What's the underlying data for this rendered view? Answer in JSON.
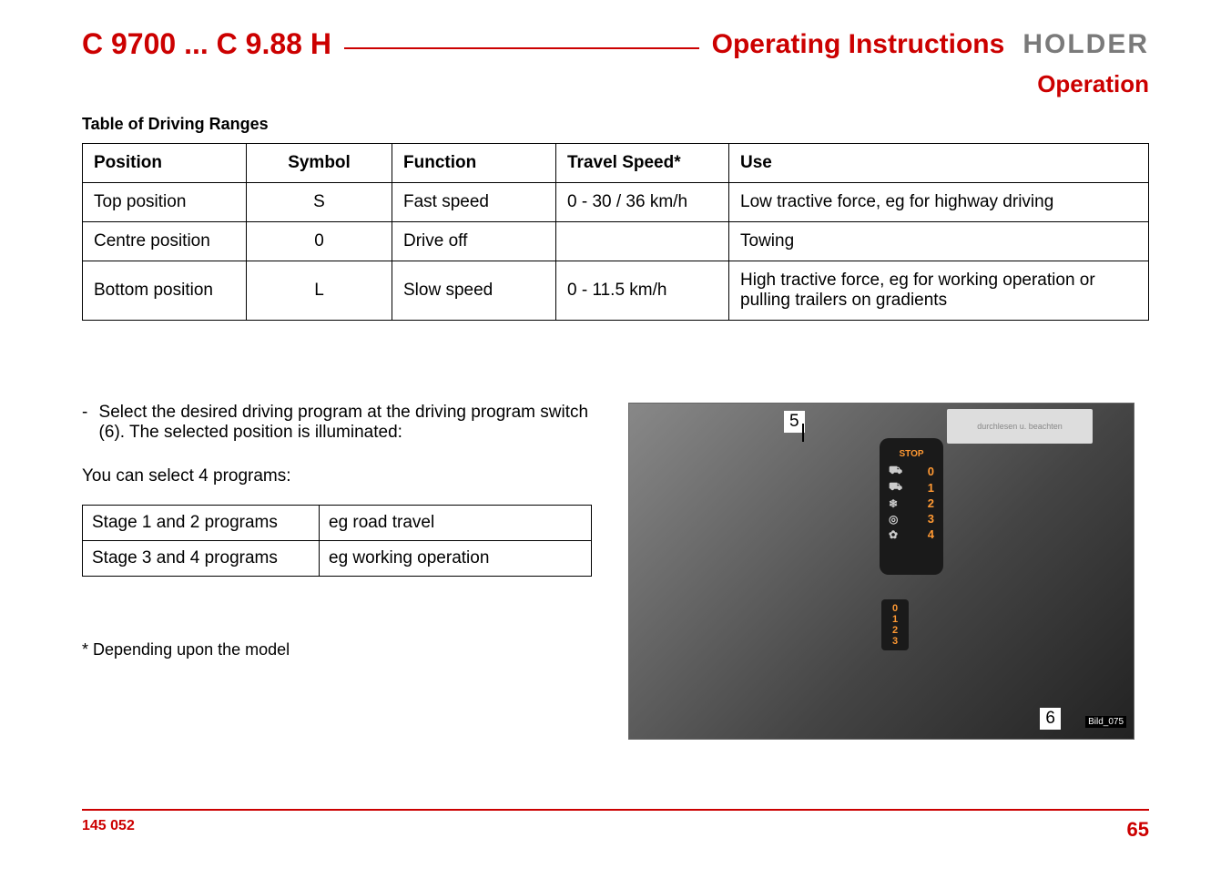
{
  "header": {
    "model": "C 9700 ... C 9.88 H",
    "doc_title": "Operating Instructions",
    "logo": "HOLDER"
  },
  "section_title": "Operation",
  "table": {
    "caption": "Table of Driving Ranges",
    "headers": [
      "Position",
      "Symbol",
      "Function",
      "Travel Speed*",
      "Use"
    ],
    "rows": [
      {
        "position": "Top position",
        "symbol": "S",
        "function": "Fast speed",
        "speed": "0 - 30 / 36 km/h",
        "use": "Low tractive force, eg for highway driving"
      },
      {
        "position": "Centre position",
        "symbol": "0",
        "function": "Drive off",
        "speed": "",
        "use": "Towing"
      },
      {
        "position": "Bottom position",
        "symbol": "L",
        "function": "Slow speed",
        "speed": "0 - 11.5 km/h",
        "use": "High tractive force, eg for working operation or pulling trailers on gradients"
      }
    ]
  },
  "instruction_text": "Select the desired driving program at the driving program switch (6). The selected position is illuminated:",
  "programs_intro": "You can select 4 programs:",
  "programs": [
    {
      "stage": "Stage 1 and 2 programs",
      "use": "eg road travel"
    },
    {
      "stage": "Stage 3 and 4 programs",
      "use": "eg working operation"
    }
  ],
  "footnote": "* Depending upon the model",
  "image": {
    "label_5": "5",
    "label_6": "6",
    "ref": "Bild_075",
    "sticker": "durchlesen u. beachten",
    "panel": {
      "stop": "STOP",
      "rows": [
        "0",
        "1",
        "2",
        "3",
        "4"
      ],
      "lower": [
        "0",
        "1",
        "2",
        "3"
      ]
    }
  },
  "footer": {
    "left": "145 052",
    "right": "65"
  }
}
